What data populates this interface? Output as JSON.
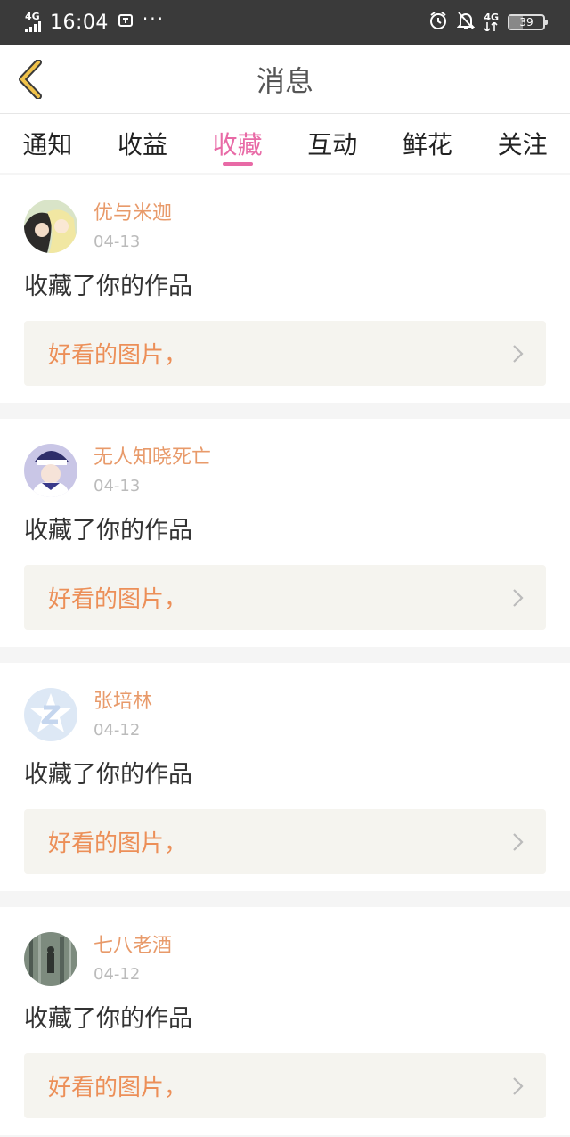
{
  "status_bar": {
    "network": "4G",
    "time": "16:04",
    "right_network": "4G",
    "battery": "39"
  },
  "header": {
    "title": "消息"
  },
  "tabs": [
    {
      "label": "通知",
      "active": false
    },
    {
      "label": "收益",
      "active": false
    },
    {
      "label": "收藏",
      "active": true
    },
    {
      "label": "互动",
      "active": false
    },
    {
      "label": "鲜花",
      "active": false
    },
    {
      "label": "关注",
      "active": false
    }
  ],
  "feed": [
    {
      "username": "优与米迦",
      "date": "04-13",
      "action": "收藏了你的作品",
      "work_title": "好看的图片，"
    },
    {
      "username": "无人知晓死亡",
      "date": "04-13",
      "action": "收藏了你的作品",
      "work_title": "好看的图片，"
    },
    {
      "username": "张培林",
      "date": "04-12",
      "action": "收藏了你的作品",
      "work_title": "好看的图片，"
    },
    {
      "username": "七八老酒",
      "date": "04-12",
      "action": "收藏了你的作品",
      "work_title": "好看的图片，"
    }
  ],
  "colors": {
    "accent": "#e86aa6",
    "username": "#e89a6a",
    "work_title": "#ec8f58",
    "back_arrow": "#f0c24a"
  }
}
